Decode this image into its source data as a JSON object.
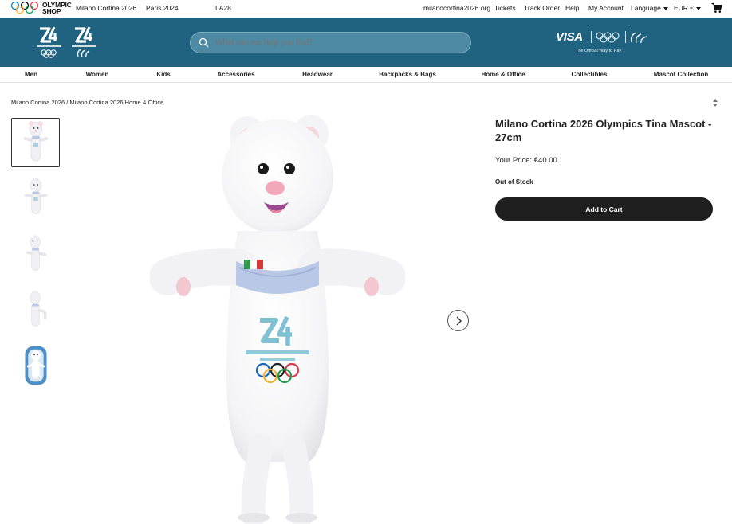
{
  "topbar": {
    "logo_line1": "OLYMPIC",
    "logo_line2": "SHOP",
    "left_links": [
      "Milano Cortina 2026",
      "Paris 2024",
      "LA28"
    ],
    "right_links": [
      "milanocortina2026.org",
      "Tickets",
      "Track Order",
      "Help",
      "My Account"
    ],
    "language_label": "Language",
    "currency_label": "EUR €"
  },
  "header": {
    "search_placeholder": "What can we help you find?",
    "visa_label": "VISA",
    "visa_tagline": "The Official Way to Pay"
  },
  "nav": {
    "categories": [
      "Men",
      "Women",
      "Kids",
      "Accessories",
      "Headwear",
      "Backpacks & Bags",
      "Home & Office",
      "Collectibles",
      "Mascot Collection"
    ]
  },
  "breadcrumb": {
    "items": [
      "Milano Cortina 2026",
      "Milano Cortina 2026 Home & Office"
    ],
    "separator": "/"
  },
  "product": {
    "title": "Milano Cortina 2026 Olympics Tina Mascot - 27cm",
    "price_label": "Your Price:",
    "price": "€40.00",
    "stock_status": "Out of Stock",
    "add_to_cart_label": "Add to Cart",
    "thumbnail_count": 5,
    "active_thumbnail": 1
  },
  "colors": {
    "header_blue": "#1f6380",
    "button_dark": "#1f1f1f",
    "search_bg": "#4e8aa3"
  }
}
